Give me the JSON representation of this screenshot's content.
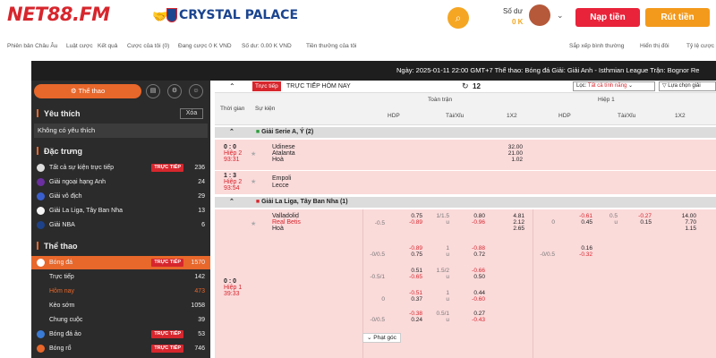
{
  "header": {
    "logo": "NET88.FM",
    "partner": "CRYSTAL PALACE",
    "balance_label": "Số dư",
    "balance_value": "0 K",
    "deposit_label": "Nạp tiền",
    "withdraw_label": "Rút tiền",
    "accent": "#d7262d"
  },
  "subnav": [
    "Phiên bản Châu Âu",
    "Luật cược",
    "Kết quả",
    "Cược của tôi (0)",
    "Đang cược 0 K VND",
    "Số dư: 0.00 K VND",
    "Tiền thưởng của tôi"
  ],
  "subnav_right": [
    "Sắp xếp bình thường",
    "Hiển thị đôi",
    "Tỷ lệ cược"
  ],
  "ticker": "Ngày: 2025-01-11 22:00 GMT+7 Thể thao: Bóng đá Giải: Giải Anh - Isthmian League Trận: Bognor Re",
  "sidebar": {
    "sport_btn": "Thể thao",
    "fav_title": "Yêu thích",
    "fav_clear": "Xóa",
    "fav_empty": "Không có yêu thích",
    "feat_title": "Đặc trưng",
    "feat_items": [
      {
        "label": "Tất cả sự kiện trực tiếp",
        "live": "TRỰC TIẾP",
        "count": "236"
      },
      {
        "label": "Giải ngoại hạng Anh",
        "live": "",
        "count": "24"
      },
      {
        "label": "Giải vô địch",
        "live": "",
        "count": "29"
      },
      {
        "label": "Giải La Liga, Tây Ban Nha",
        "live": "",
        "count": "13"
      },
      {
        "label": "Giải NBA",
        "live": "",
        "count": "6"
      }
    ],
    "sport_title": "Thể thao",
    "sport_items": [
      {
        "label": "Bóng đá",
        "live": "TRỰC TIẾP",
        "count": "1570"
      },
      {
        "label": "Trực tiếp",
        "live": "",
        "count": "142"
      },
      {
        "label": "Hôm nay",
        "live": "",
        "count": "473"
      },
      {
        "label": "Kèo sớm",
        "live": "",
        "count": "1058"
      },
      {
        "label": "Chung cuộc",
        "live": "",
        "count": "39"
      },
      {
        "label": "Bóng đá ảo",
        "live": "TRỰC TIẾP",
        "count": "53"
      },
      {
        "label": "Bóng rổ",
        "live": "TRỰC TIẾP",
        "count": "746"
      }
    ]
  },
  "table": {
    "live_badge": "Trực tiếp",
    "title": "TRỰC TIẾP HÔM NAY",
    "refresh_count": "12",
    "filter_label": "Lọc",
    "filter_value": "Tất cả tính năng",
    "choose_label": "Lựa chọn giải",
    "col_time": "Thời gian",
    "col_event": "Sự kiện",
    "grp_full": "Toàn trận",
    "grp_half": "Hiệp 1",
    "cols": [
      "HDP",
      "Tài/Xỉu",
      "1X2",
      "HDP",
      "Tài/Xỉu",
      "1X2"
    ],
    "league1": "Giải Serie A, Ý (2)",
    "m1": {
      "score": "0 : 0",
      "period": "Hiệp 2",
      "clock": "93:31",
      "home": "Udinese",
      "away": "Atalanta",
      "draw": "Hoà",
      "x12": [
        "32.00",
        "21.00",
        "1.02"
      ]
    },
    "m2": {
      "score": "1 : 3",
      "period": "Hiệp 2",
      "clock": "93:54",
      "home": "Empoli",
      "away": "Lecce"
    },
    "league2": "Giải La Liga, Tây Ban Nha (1)",
    "m3": {
      "score": "0 : 0",
      "period": "Hiệp 1",
      "clock": "39:33",
      "home": "Valladolid",
      "away": "Real Betis",
      "draw": "Hoà"
    },
    "r1": {
      "hdp": "-0.5",
      "h1": "0.75",
      "h2": "-0.89",
      "ou": "1/1.5",
      "ou2": "u",
      "o1": "0.80",
      "o2": "-0.96",
      "x12": [
        "4.81",
        "2.12",
        "2.65"
      ],
      "fh_hdp": "0",
      "fh1": "-0.61",
      "fh2": "0.45",
      "fh_ou": "0.5",
      "fh_ou2": "u",
      "fho1": "-0.27",
      "fho2": "0.15",
      "fh_x12": [
        "14.00",
        "7.70",
        "1.15"
      ]
    },
    "r2": {
      "hdp": "-0/0.5",
      "h1": "-0.89",
      "h2": "0.75",
      "ou": "1",
      "ou2": "u",
      "o1": "-0.88",
      "o2": "0.72",
      "fh_hdp": "-0/0.5",
      "fh1": "0.16",
      "fh2": "-0.32"
    },
    "r3": {
      "hdp": "-0.5/1",
      "h1": "0.51",
      "h2": "-0.65",
      "ou": "1.5/2",
      "ou2": "u",
      "o1": "-0.66",
      "o2": "0.50"
    },
    "r4": {
      "hdp": "0",
      "h1": "-0.51",
      "h2": "0.37",
      "ou": "1",
      "ou2": "u",
      "o1": "0.44",
      "o2": "-0.60"
    },
    "r5": {
      "hdp": "-0/0.5",
      "h1": "-0.38",
      "h2": "0.24",
      "ou": "0.5/1",
      "ou2": "u",
      "o1": "0.27",
      "o2": "-0.43"
    },
    "corner": "Phạt góc"
  }
}
